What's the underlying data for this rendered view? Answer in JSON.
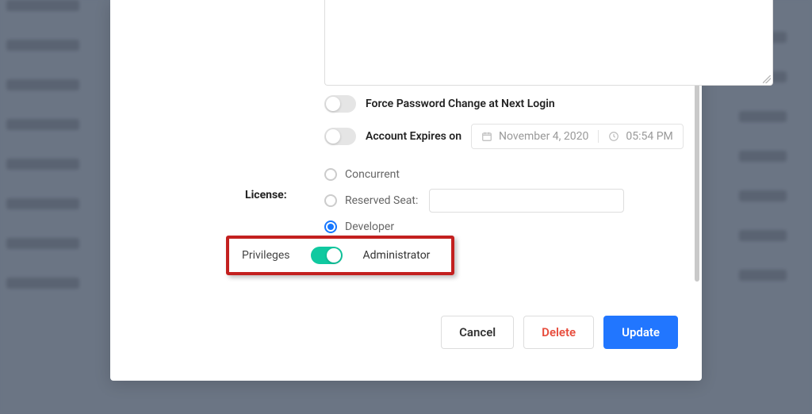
{
  "form": {
    "force_password_label": "Force Password Change at Next Login",
    "force_password_on": false,
    "account_expires_label": "Account Expires on",
    "account_expires_on": false,
    "expire_date": "November 4, 2020",
    "expire_time": "05:54 PM"
  },
  "license": {
    "label": "License:",
    "options": {
      "concurrent": "Concurrent",
      "reserved_seat": "Reserved Seat:",
      "developer": "Developer"
    },
    "selected": "developer",
    "reserved_value": ""
  },
  "privileges": {
    "label": "Privileges",
    "admin_label": "Administrator",
    "admin_on": true
  },
  "buttons": {
    "cancel": "Cancel",
    "delete": "Delete",
    "update": "Update"
  }
}
